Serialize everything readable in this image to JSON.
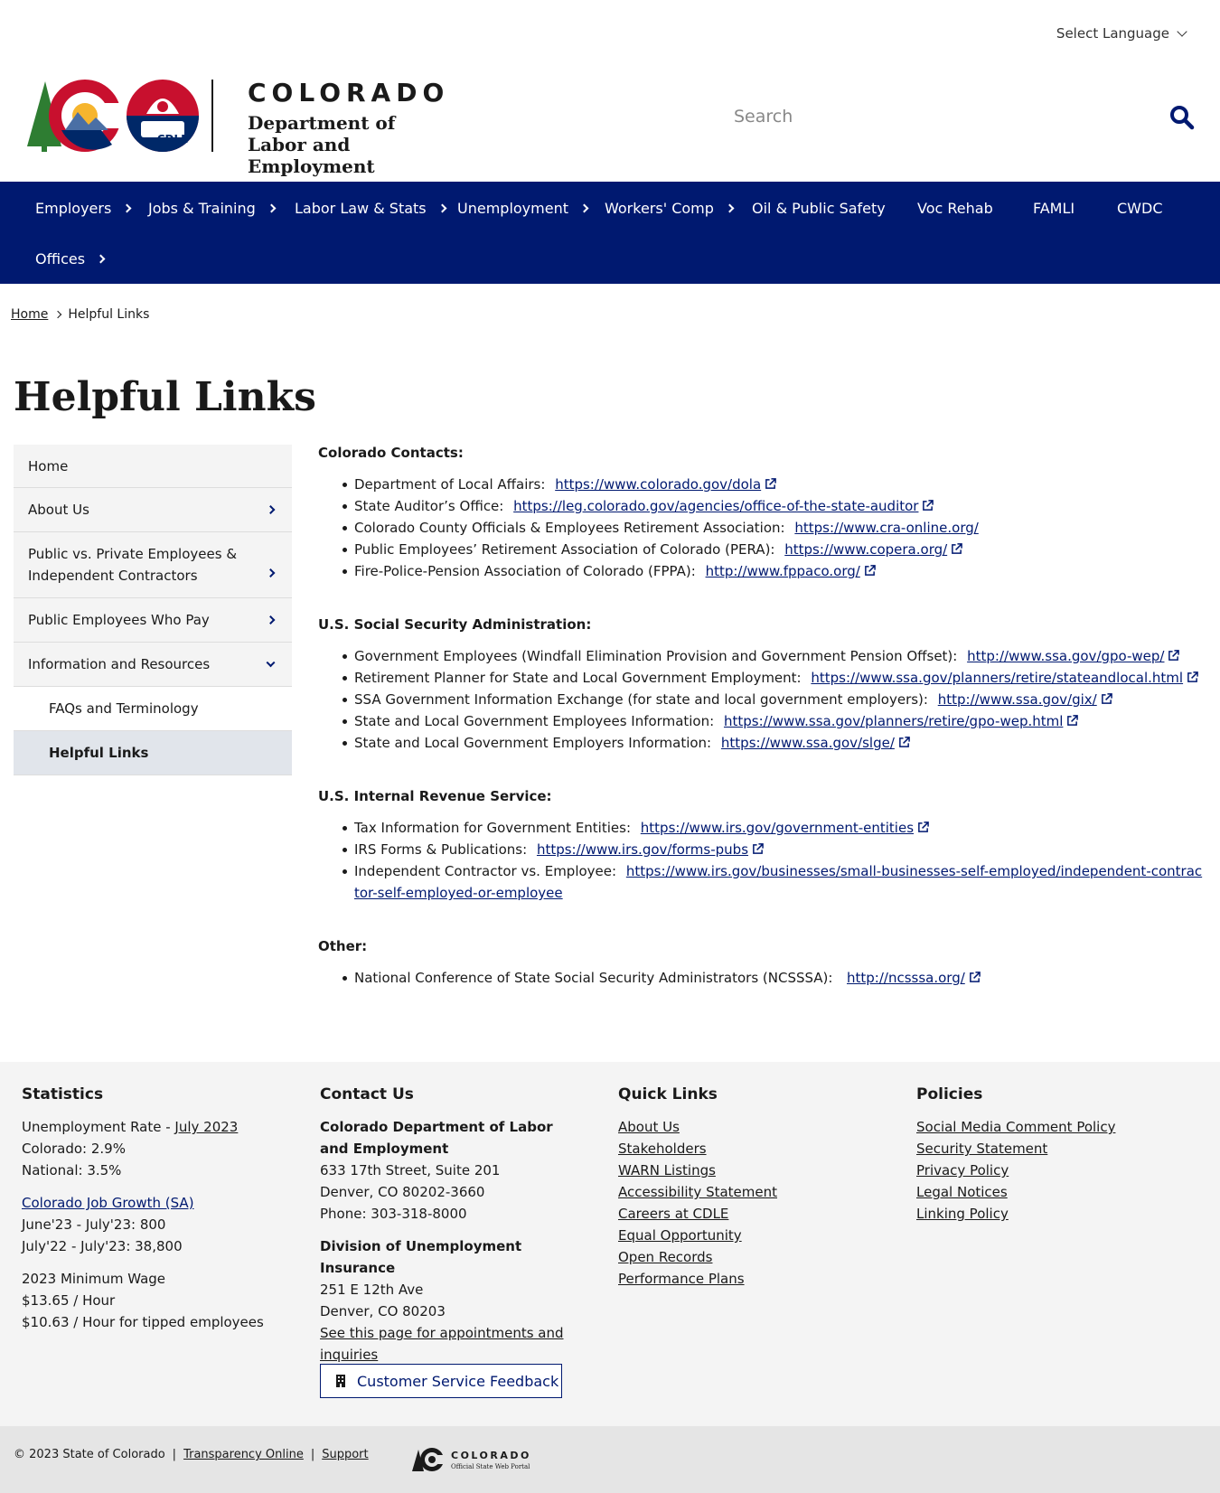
{
  "header": {
    "language_label": "Select Language",
    "logo_word": "COLORADO",
    "logo_dept_line1": "Department of",
    "logo_dept_line2": "Labor and Employment",
    "logo_badge": "CDLE",
    "search_placeholder": "Search"
  },
  "nav": {
    "items": [
      {
        "label": "Employers"
      },
      {
        "label": "Jobs & Training"
      },
      {
        "label": "Labor Law & Stats"
      },
      {
        "label": "Unemployment"
      },
      {
        "label": "Workers' Comp"
      },
      {
        "label": "Oil & Public Safety"
      },
      {
        "label": "Voc Rehab"
      },
      {
        "label": "FAMLI"
      },
      {
        "label": "CWDC"
      },
      {
        "label": "Offices"
      }
    ]
  },
  "breadcrumb": {
    "home": "Home",
    "current": "Helpful Links"
  },
  "page_title": "Helpful Links",
  "sidebar": {
    "items": [
      {
        "label": "Home"
      },
      {
        "label": "About Us"
      },
      {
        "label": "Public vs. Private Employees & Independent Contractors"
      },
      {
        "label": "Public Employees Who Pay"
      },
      {
        "label": "Information and Resources"
      },
      {
        "label": "FAQs and Terminology"
      },
      {
        "label": "Helpful Links"
      }
    ]
  },
  "sections": [
    {
      "heading": "Colorado Contacts:",
      "items": [
        {
          "text": "Department of Local Affairs:",
          "link": "https://www.colorado.gov/dola"
        },
        {
          "text": "State Auditor’s Office:",
          "link": "https://leg.colorado.gov/agencies/office-of-the-state-auditor"
        },
        {
          "text": "Colorado County Officials & Employees Retirement Association:",
          "link": "https://www.cra-online.org/"
        },
        {
          "text": "Public Employees’ Retirement Association of Colorado (PERA):",
          "link": "https://www.copera.org/"
        },
        {
          "text": "Fire-Police-Pension Association of Colorado (FPPA):",
          "link": "http://www.fppaco.org/"
        }
      ]
    },
    {
      "heading": "U.S. Social Security Administration:",
      "items": [
        {
          "text": "Government Employees (Windfall Elimination Provision and Government Pension Offset):",
          "link": "http://www.ssa.gov/gpo-wep/"
        },
        {
          "text": "Retirement Planner for State and Local Government Employment:",
          "link": "https://www.ssa.gov/planners/retire/stateandlocal.html"
        },
        {
          "text": "SSA Government Information Exchange (for state and local government employers):",
          "link": "http://www.ssa.gov/gix/"
        },
        {
          "text": "State and Local Government Employees Information:",
          "link": "https://www.ssa.gov/planners/retire/gpo-wep.html"
        },
        {
          "text": "State and Local Government Employers Information:",
          "link": "https://www.ssa.gov/slge/"
        }
      ]
    },
    {
      "heading": "U.S. Internal Revenue Service:",
      "items": [
        {
          "text": "Tax Information for Government Entities:",
          "link": "https://www.irs.gov/government-entities"
        },
        {
          "text": "IRS Forms & Publications:",
          "link": "https://www.irs.gov/forms-pubs"
        },
        {
          "text": "Independent Contractor vs. Employee:",
          "link": "https://www.irs.gov/businesses/small-businesses-self-employed/independent-contractor-self-employed-or-employee"
        }
      ]
    },
    {
      "heading": "Other:",
      "items": [
        {
          "text": "National Conference of State Social Security Administrators (NCSSSA):",
          "link": "http://ncsssa.org/"
        }
      ]
    }
  ],
  "footer": {
    "statistics": {
      "title": "Statistics",
      "unemp_label": "Unemployment Rate - ",
      "unemp_link": "July 2023",
      "colorado": "Colorado: 2.9%",
      "national": "National: 3.5%",
      "job_growth_link": "Colorado Job Growth (SA)",
      "jg1": "June'23 - July'23: 800",
      "jg2": "July'22 - July'23: 38,800",
      "min_wage_title": "2023 Minimum Wage",
      "mw1": "$13.65 / Hour",
      "mw2": "$10.63 / Hour for tipped employees"
    },
    "contact": {
      "title": "Contact Us",
      "org": "Colorado Department of Labor and Employment",
      "addr1": "633 17th Street, Suite 201",
      "addr2": "Denver, CO  80202-3660",
      "phone": "Phone: 303-318-8000",
      "div": "Division of Unemployment Insurance",
      "div_addr1": "251 E 12th Ave",
      "div_addr2": "Denver, CO  80203",
      "appt_link": "See this page for appointments and inquiries",
      "feedback": "Customer Service Feedback"
    },
    "quick_links": {
      "title": "Quick Links",
      "links": [
        "About Us",
        "Stakeholders",
        "WARN Listings",
        "Accessibility Statement",
        "Careers at CDLE",
        "Equal Opportunity",
        "Open Records",
        "Performance Plans"
      ]
    },
    "policies": {
      "title": "Policies",
      "links": [
        "Social Media Comment Policy",
        "Security Statement",
        "Privacy Policy",
        "Legal Notices",
        "Linking Policy"
      ]
    }
  },
  "bottom_bar": {
    "copyright": "© 2023 State of Colorado",
    "sep": "|",
    "transparency": "Transparency Online",
    "support": "Support",
    "portal_word": "COLORADO",
    "portal_sub": "Official State Web Portal"
  },
  "colors": {
    "nav_bg": "#001970",
    "link": "#001970",
    "footer_bg": "#f4f4f4"
  }
}
